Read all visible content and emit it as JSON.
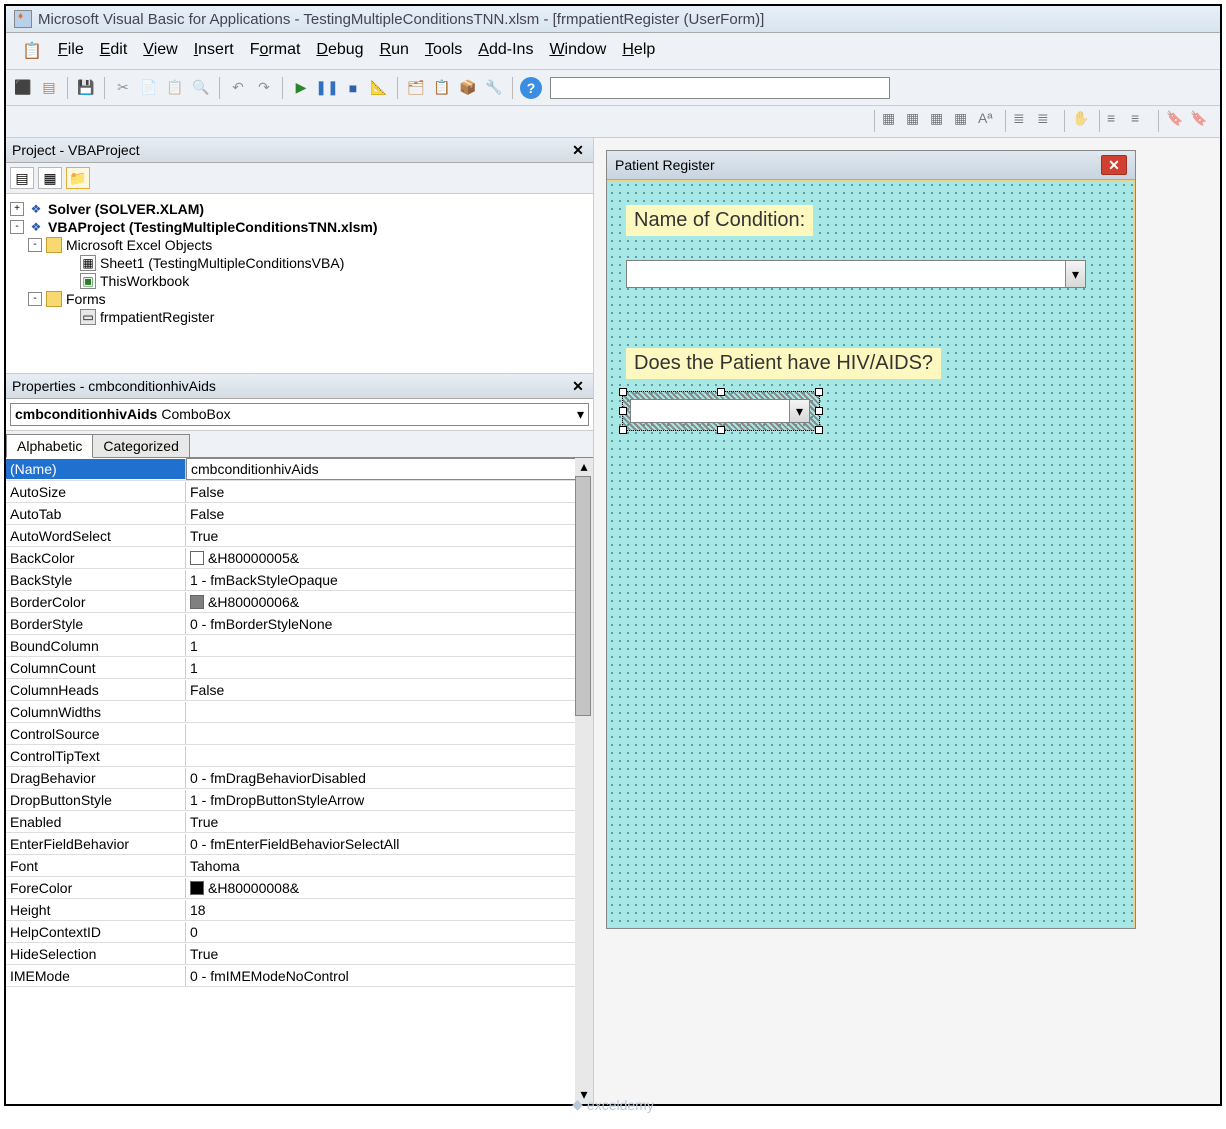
{
  "title": "Microsoft Visual Basic for Applications - TestingMultipleConditionsTNN.xlsm - [frmpatientRegister (UserForm)]",
  "menus": [
    "File",
    "Edit",
    "View",
    "Insert",
    "Format",
    "Debug",
    "Run",
    "Tools",
    "Add-Ins",
    "Window",
    "Help"
  ],
  "project_panel": {
    "title": "Project - VBAProject",
    "tree": {
      "solver": "Solver (SOLVER.XLAM)",
      "vbaproject": "VBAProject (TestingMultipleConditionsTNN.xlsm)",
      "excel_objects": "Microsoft Excel Objects",
      "sheet1": "Sheet1 (TestingMultipleConditionsVBA)",
      "thisworkbook": "ThisWorkbook",
      "forms": "Forms",
      "form1": "frmpatientRegister"
    }
  },
  "properties_panel": {
    "title": "Properties - cmbconditionhivAids",
    "object_name": "cmbconditionhivAids",
    "object_type": "ComboBox",
    "tabs": [
      "Alphabetic",
      "Categorized"
    ],
    "rows": [
      {
        "name": "(Name)",
        "value": "cmbconditionhivAids",
        "selected": true
      },
      {
        "name": "AutoSize",
        "value": "False"
      },
      {
        "name": "AutoTab",
        "value": "False"
      },
      {
        "name": "AutoWordSelect",
        "value": "True"
      },
      {
        "name": "BackColor",
        "value": "&H80000005&",
        "swatch": "#ffffff"
      },
      {
        "name": "BackStyle",
        "value": "1 - fmBackStyleOpaque"
      },
      {
        "name": "BorderColor",
        "value": "&H80000006&",
        "swatch": "#808080"
      },
      {
        "name": "BorderStyle",
        "value": "0 - fmBorderStyleNone"
      },
      {
        "name": "BoundColumn",
        "value": "1"
      },
      {
        "name": "ColumnCount",
        "value": "1"
      },
      {
        "name": "ColumnHeads",
        "value": "False"
      },
      {
        "name": "ColumnWidths",
        "value": ""
      },
      {
        "name": "ControlSource",
        "value": ""
      },
      {
        "name": "ControlTipText",
        "value": ""
      },
      {
        "name": "DragBehavior",
        "value": "0 - fmDragBehaviorDisabled"
      },
      {
        "name": "DropButtonStyle",
        "value": "1 - fmDropButtonStyleArrow"
      },
      {
        "name": "Enabled",
        "value": "True"
      },
      {
        "name": "EnterFieldBehavior",
        "value": "0 - fmEnterFieldBehaviorSelectAll"
      },
      {
        "name": "Font",
        "value": "Tahoma"
      },
      {
        "name": "ForeColor",
        "value": "&H80000008&",
        "swatch": "#000000"
      },
      {
        "name": "Height",
        "value": "18"
      },
      {
        "name": "HelpContextID",
        "value": "0"
      },
      {
        "name": "HideSelection",
        "value": "True"
      },
      {
        "name": "IMEMode",
        "value": "0 - fmIMEModeNoControl",
        "cut": true
      }
    ]
  },
  "userform": {
    "title": "Patient Register",
    "label1": "Name of Condition:",
    "label2": "Does the Patient have HIV/AIDS?"
  },
  "watermark": "exceldemy"
}
